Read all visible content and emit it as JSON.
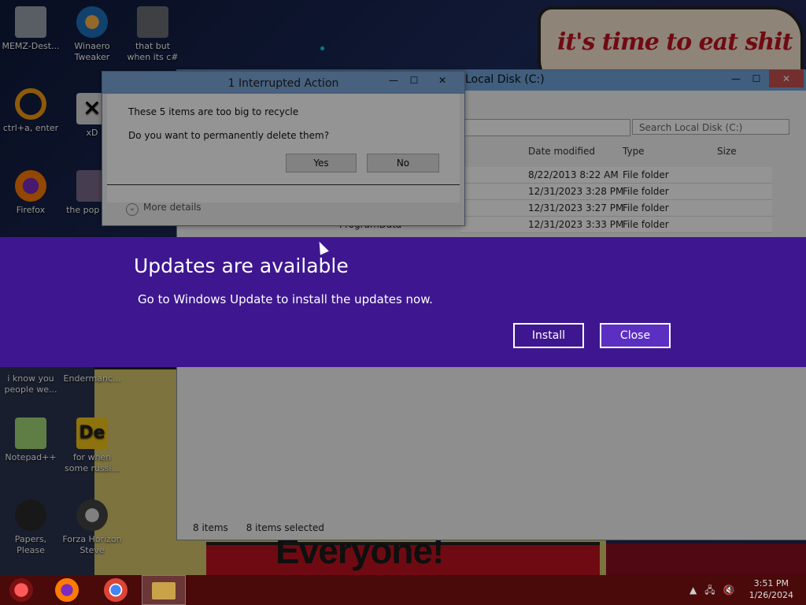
{
  "desktop": {
    "wallpaper_text": "it's time to eat shit",
    "banner_text": "Everyone!",
    "icons": [
      {
        "label": "MEMZ-Dest..."
      },
      {
        "label": "Winaero Tweaker"
      },
      {
        "label": "that but when its c#"
      },
      {
        "label": "ctrl+a, enter"
      },
      {
        "label": "xD"
      },
      {
        "label": "Firefox"
      },
      {
        "label": "the pop shit"
      },
      {
        "label": "i know you people we..."
      },
      {
        "label": "Endermanc..."
      },
      {
        "label": "Notepad++"
      },
      {
        "label": "for when some russi..."
      },
      {
        "label": "Papers, Please"
      },
      {
        "label": "Forza Horizon Steve"
      }
    ]
  },
  "explorer": {
    "title": "Local Disk (C:)",
    "search_placeholder": "Search Local Disk (C:)",
    "columns": [
      "Date modified",
      "Type",
      "Size"
    ],
    "rows": [
      {
        "name": "",
        "date": "8/22/2013 8:22 AM",
        "type": "File folder"
      },
      {
        "name": "",
        "date": "12/31/2023 3:28 PM",
        "type": "File folder"
      },
      {
        "name": "",
        "date": "12/31/2023 3:27 PM",
        "type": "File folder"
      },
      {
        "name": "ProgramData",
        "date": "12/31/2023 3:33 PM",
        "type": "File folder"
      }
    ],
    "status_count": "8 items",
    "status_selected": "8 items selected"
  },
  "dialog": {
    "title": "1 Interrupted Action",
    "line1": "These 5 items are too big to recycle",
    "line2": "Do you want to permanently delete them?",
    "yes": "Yes",
    "no": "No",
    "more_details": "More details"
  },
  "update_banner": {
    "heading": "Updates are available",
    "message": "Go to Windows Update to install the updates now.",
    "install": "Install",
    "close": "Close",
    "bg_color": "#3e1790"
  },
  "taskbar": {
    "time": "3:51 PM",
    "date": "1/26/2024"
  }
}
